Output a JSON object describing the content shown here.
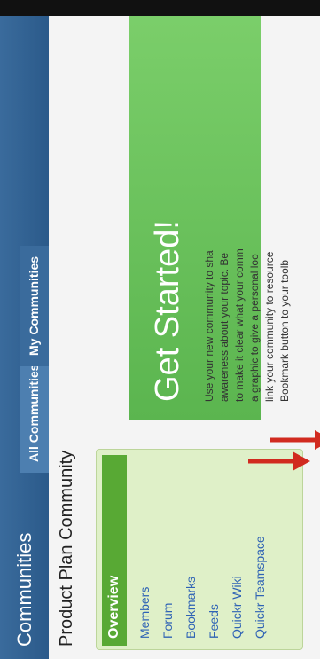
{
  "header": {
    "title": "Communities",
    "tabs": [
      {
        "label": "All Communities"
      },
      {
        "label": "My Communities"
      }
    ]
  },
  "page": {
    "title": "Product Plan Community"
  },
  "nav": {
    "items": [
      {
        "label": "Overview"
      },
      {
        "label": "Members"
      },
      {
        "label": "Forum"
      },
      {
        "label": "Bookmarks"
      },
      {
        "label": "Feeds"
      },
      {
        "label": "Quickr Wiki"
      },
      {
        "label": "Quickr Teamspace"
      }
    ]
  },
  "hero": {
    "title": "Get Started!",
    "body_lines": [
      "Use your new community to sha",
      "awareness about your topic. Be",
      "to make it clear what your comm",
      "a graphic to give a personal loo",
      "link your community to resource",
      "Bookmark button to your toolb"
    ]
  },
  "colors": {
    "accent_green": "#58a934",
    "header_blue": "#2b5a8a",
    "link_blue": "#2f63b5",
    "arrow_red": "#d12a1f"
  }
}
